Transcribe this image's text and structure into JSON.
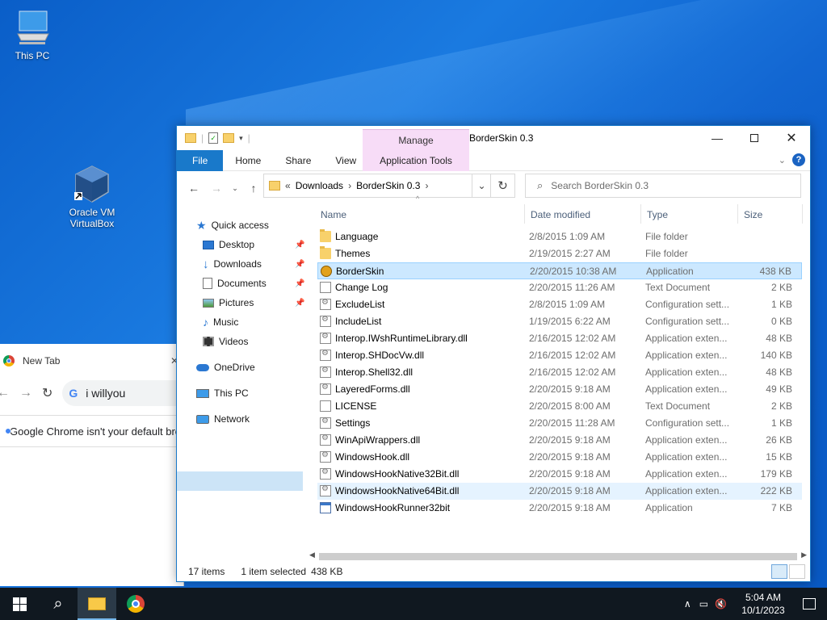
{
  "desktop": {
    "icons": [
      {
        "label": "This PC",
        "icon": "computer-icon"
      },
      {
        "label": "Oracle VM VirtualBox",
        "icon": "virtualbox-icon"
      }
    ]
  },
  "chrome": {
    "tab_title": "New Tab",
    "close_tab": "✕",
    "omnibox_text": "i willyou",
    "infobar_text": "Google Chrome isn't your default browser"
  },
  "explorer": {
    "title": "BorderSkin 0.3",
    "manage_tab": "Manage",
    "ribbon_tabs": [
      "File",
      "Home",
      "Share",
      "View"
    ],
    "app_tools_tab": "Application Tools",
    "breadcrumb": {
      "overflow": "«",
      "items": [
        "Downloads",
        "BorderSkin 0.3"
      ]
    },
    "search_placeholder": "Search BorderSkin 0.3",
    "nav_pane": [
      {
        "label": "Quick access",
        "icon": "star-icon",
        "pinned": false
      },
      {
        "label": "Desktop",
        "icon": "desktop-folder-icon",
        "pinned": true
      },
      {
        "label": "Downloads",
        "icon": "download-arrow-icon",
        "pinned": true
      },
      {
        "label": "Documents",
        "icon": "documents-folder-icon",
        "pinned": true
      },
      {
        "label": "Pictures",
        "icon": "pictures-folder-icon",
        "pinned": true
      },
      {
        "label": "Music",
        "icon": "music-note-icon",
        "pinned": false
      },
      {
        "label": "Videos",
        "icon": "videos-folder-icon",
        "pinned": false
      },
      {
        "label": "OneDrive",
        "icon": "cloud-icon",
        "pinned": false
      },
      {
        "label": "This PC",
        "icon": "computer-icon",
        "pinned": false,
        "selected": true
      },
      {
        "label": "Network",
        "icon": "network-icon",
        "pinned": false
      }
    ],
    "columns": [
      "Name",
      "Date modified",
      "Type",
      "Size"
    ],
    "files": [
      {
        "name": "Language",
        "date": "2/8/2015 1:09 AM",
        "type": "File folder",
        "size": "",
        "icon": "folder"
      },
      {
        "name": "Themes",
        "date": "2/19/2015 2:27 AM",
        "type": "File folder",
        "size": "",
        "icon": "folder"
      },
      {
        "name": "BorderSkin",
        "date": "2/20/2015 10:38 AM",
        "type": "Application",
        "size": "438 KB",
        "icon": "app",
        "selected": true
      },
      {
        "name": "Change Log",
        "date": "2/20/2015 11:26 AM",
        "type": "Text Document",
        "size": "2 KB",
        "icon": "doc"
      },
      {
        "name": "ExcludeList",
        "date": "2/8/2015 1:09 AM",
        "type": "Configuration sett...",
        "size": "1 KB",
        "icon": "cfg"
      },
      {
        "name": "IncludeList",
        "date": "1/19/2015 6:22 AM",
        "type": "Configuration sett...",
        "size": "0 KB",
        "icon": "cfg"
      },
      {
        "name": "Interop.IWshRuntimeLibrary.dll",
        "date": "2/16/2015 12:02 AM",
        "type": "Application exten...",
        "size": "48 KB",
        "icon": "cfg"
      },
      {
        "name": "Interop.SHDocVw.dll",
        "date": "2/16/2015 12:02 AM",
        "type": "Application exten...",
        "size": "140 KB",
        "icon": "cfg"
      },
      {
        "name": "Interop.Shell32.dll",
        "date": "2/16/2015 12:02 AM",
        "type": "Application exten...",
        "size": "48 KB",
        "icon": "cfg"
      },
      {
        "name": "LayeredForms.dll",
        "date": "2/20/2015 9:18 AM",
        "type": "Application exten...",
        "size": "49 KB",
        "icon": "cfg"
      },
      {
        "name": "LICENSE",
        "date": "2/20/2015 8:00 AM",
        "type": "Text Document",
        "size": "2 KB",
        "icon": "doc"
      },
      {
        "name": "Settings",
        "date": "2/20/2015 11:28 AM",
        "type": "Configuration sett...",
        "size": "1 KB",
        "icon": "cfg"
      },
      {
        "name": "WinApiWrappers.dll",
        "date": "2/20/2015 9:18 AM",
        "type": "Application exten...",
        "size": "26 KB",
        "icon": "cfg"
      },
      {
        "name": "WindowsHook.dll",
        "date": "2/20/2015 9:18 AM",
        "type": "Application exten...",
        "size": "15 KB",
        "icon": "cfg"
      },
      {
        "name": "WindowsHookNative32Bit.dll",
        "date": "2/20/2015 9:18 AM",
        "type": "Application exten...",
        "size": "179 KB",
        "icon": "cfg"
      },
      {
        "name": "WindowsHookNative64Bit.dll",
        "date": "2/20/2015 9:18 AM",
        "type": "Application exten...",
        "size": "222 KB",
        "icon": "cfg",
        "hover": true
      },
      {
        "name": "WindowsHookRunner32bit",
        "date": "2/20/2015 9:18 AM",
        "type": "Application",
        "size": "7 KB",
        "icon": "exe"
      }
    ],
    "status": {
      "count": "17 items",
      "selection": "1 item selected",
      "size": "438 KB"
    }
  },
  "taskbar": {
    "time": "5:04 AM",
    "date": "10/1/2023",
    "buttons": [
      "windows-start-icon",
      "search-icon",
      "file-explorer-icon",
      "chrome-icon"
    ]
  },
  "colors": {
    "accent": "#1979ca",
    "selection": "#cce8ff",
    "manage": "#f7dcf7"
  }
}
